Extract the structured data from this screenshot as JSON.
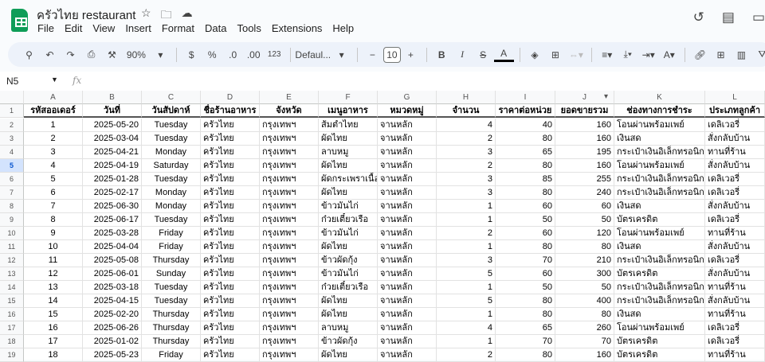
{
  "app": {
    "title": "ครัวไทย restaurant",
    "menu": [
      "File",
      "Edit",
      "View",
      "Insert",
      "Format",
      "Data",
      "Tools",
      "Extensions",
      "Help"
    ]
  },
  "toolbar": {
    "zoom": "90%",
    "currency": "$",
    "percent": "%",
    "dec_decrease": ".0",
    "dec_increase": ".00",
    "number_format": "123",
    "font": "Defaul...",
    "font_size": "10",
    "bold": "B",
    "italic": "I",
    "text_color": "A"
  },
  "formula_bar": {
    "name_box": "N5",
    "fx": "fx",
    "value": ""
  },
  "selected_row": 5,
  "columns": [
    "A",
    "B",
    "C",
    "D",
    "E",
    "F",
    "G",
    "H",
    "I",
    "J",
    "K",
    "L"
  ],
  "headers": [
    "รหัสออเดอร์",
    "วันที่",
    "วันสัปดาห์",
    "ชื่อร้านอาหาร",
    "จังหวัด",
    "เมนูอาหาร",
    "หมวดหมู่",
    "จำนวน",
    "ราคาต่อหน่วย",
    "ยอดขายรวม",
    "ช่องทางการชำระ",
    "ประเภทลูกค้า"
  ],
  "rows": [
    [
      "1",
      "2025-05-20",
      "Tuesday",
      "ครัวไทย",
      "กรุงเทพฯ",
      "ส้มตำไทย",
      "จานหลัก",
      "4",
      "40",
      "160",
      "โอนผ่านพร้อมเพย์",
      "เดลิเวอรี่"
    ],
    [
      "2",
      "2025-03-04",
      "Tuesday",
      "ครัวไทย",
      "กรุงเทพฯ",
      "ผัดไทย",
      "จานหลัก",
      "2",
      "80",
      "160",
      "เงินสด",
      "สั่งกลับบ้าน"
    ],
    [
      "3",
      "2025-04-21",
      "Monday",
      "ครัวไทย",
      "กรุงเทพฯ",
      "ลาบหมู",
      "จานหลัก",
      "3",
      "65",
      "195",
      "กระเป๋าเงินอิเล็กทรอนิกส์",
      "ทานที่ร้าน"
    ],
    [
      "4",
      "2025-04-19",
      "Saturday",
      "ครัวไทย",
      "กรุงเทพฯ",
      "ผัดไทย",
      "จานหลัก",
      "2",
      "80",
      "160",
      "โอนผ่านพร้อมเพย์",
      "สั่งกลับบ้าน"
    ],
    [
      "5",
      "2025-01-28",
      "Tuesday",
      "ครัวไทย",
      "กรุงเทพฯ",
      "ผัดกระเพราเนื้อ",
      "จานหลัก",
      "3",
      "85",
      "255",
      "กระเป๋าเงินอิเล็กทรอนิกส์",
      "เดลิเวอรี่"
    ],
    [
      "6",
      "2025-02-17",
      "Monday",
      "ครัวไทย",
      "กรุงเทพฯ",
      "ผัดไทย",
      "จานหลัก",
      "3",
      "80",
      "240",
      "กระเป๋าเงินอิเล็กทรอนิกส์",
      "เดลิเวอรี่"
    ],
    [
      "7",
      "2025-06-30",
      "Monday",
      "ครัวไทย",
      "กรุงเทพฯ",
      "ข้าวมันไก่",
      "จานหลัก",
      "1",
      "60",
      "60",
      "เงินสด",
      "สั่งกลับบ้าน"
    ],
    [
      "8",
      "2025-06-17",
      "Tuesday",
      "ครัวไทย",
      "กรุงเทพฯ",
      "ก๋วยเตี๋ยวเรือ",
      "จานหลัก",
      "1",
      "50",
      "50",
      "บัตรเครดิต",
      "เดลิเวอรี่"
    ],
    [
      "9",
      "2025-03-28",
      "Friday",
      "ครัวไทย",
      "กรุงเทพฯ",
      "ข้าวมันไก่",
      "จานหลัก",
      "2",
      "60",
      "120",
      "โอนผ่านพร้อมเพย์",
      "ทานที่ร้าน"
    ],
    [
      "10",
      "2025-04-04",
      "Friday",
      "ครัวไทย",
      "กรุงเทพฯ",
      "ผัดไทย",
      "จานหลัก",
      "1",
      "80",
      "80",
      "เงินสด",
      "สั่งกลับบ้าน"
    ],
    [
      "11",
      "2025-05-08",
      "Thursday",
      "ครัวไทย",
      "กรุงเทพฯ",
      "ข้าวผัดกุ้ง",
      "จานหลัก",
      "3",
      "70",
      "210",
      "กระเป๋าเงินอิเล็กทรอนิกส์",
      "เดลิเวอรี่"
    ],
    [
      "12",
      "2025-06-01",
      "Sunday",
      "ครัวไทย",
      "กรุงเทพฯ",
      "ข้าวมันไก่",
      "จานหลัก",
      "5",
      "60",
      "300",
      "บัตรเครดิต",
      "สั่งกลับบ้าน"
    ],
    [
      "13",
      "2025-03-18",
      "Tuesday",
      "ครัวไทย",
      "กรุงเทพฯ",
      "ก๋วยเตี๋ยวเรือ",
      "จานหลัก",
      "1",
      "50",
      "50",
      "กระเป๋าเงินอิเล็กทรอนิกส์",
      "ทานที่ร้าน"
    ],
    [
      "14",
      "2025-04-15",
      "Tuesday",
      "ครัวไทย",
      "กรุงเทพฯ",
      "ผัดไทย",
      "จานหลัก",
      "5",
      "80",
      "400",
      "กระเป๋าเงินอิเล็กทรอนิกส์",
      "สั่งกลับบ้าน"
    ],
    [
      "15",
      "2025-02-20",
      "Thursday",
      "ครัวไทย",
      "กรุงเทพฯ",
      "ผัดไทย",
      "จานหลัก",
      "1",
      "80",
      "80",
      "เงินสด",
      "ทานที่ร้าน"
    ],
    [
      "16",
      "2025-06-26",
      "Thursday",
      "ครัวไทย",
      "กรุงเทพฯ",
      "ลาบหมู",
      "จานหลัก",
      "4",
      "65",
      "260",
      "โอนผ่านพร้อมเพย์",
      "เดลิเวอรี่"
    ],
    [
      "17",
      "2025-01-02",
      "Thursday",
      "ครัวไทย",
      "กรุงเทพฯ",
      "ข้าวผัดกุ้ง",
      "จานหลัก",
      "1",
      "70",
      "70",
      "บัตรเครดิต",
      "เดลิเวอรี่"
    ],
    [
      "18",
      "2025-05-23",
      "Friday",
      "ครัวไทย",
      "กรุงเทพฯ",
      "ผัดไทย",
      "จานหลัก",
      "2",
      "80",
      "160",
      "บัตรเครดิต",
      "ทานที่ร้าน"
    ]
  ]
}
